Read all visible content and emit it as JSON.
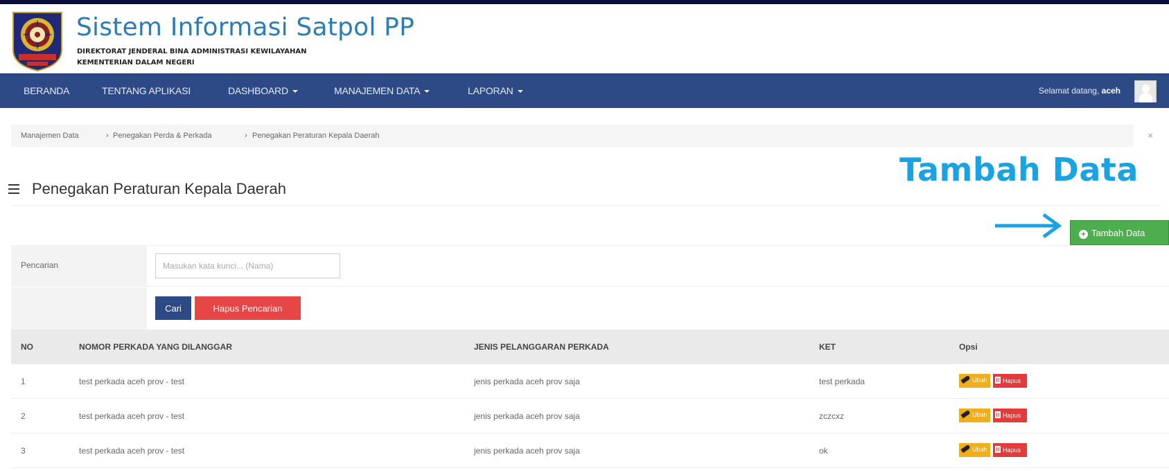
{
  "header": {
    "title": "Sistem Informasi Satpol PP",
    "subtitle_line1": "DIREKTORAT JENDERAL BINA ADMINISTRASI KEWILAYAHAN",
    "subtitle_line2": "KEMENTERIAN DALAM NEGERI"
  },
  "nav": {
    "items": [
      {
        "label": "BERANDA"
      },
      {
        "label": "TENTANG APLIKASI"
      },
      {
        "label": "DASHBOARD"
      },
      {
        "label": "MANAJEMEN DATA"
      },
      {
        "label": "LAPORAN"
      }
    ],
    "welcome_text": "Selamat datang,",
    "username": "aceh"
  },
  "breadcrumb": {
    "items": [
      "Manajemen Data",
      "Penegakan Perda & Perkada",
      "Penegakan Peraturan Kepala Daerah"
    ],
    "separator": "›",
    "close": "×"
  },
  "annotation": {
    "title": "Tambah Data"
  },
  "page": {
    "heading": "Penegakan Peraturan Kepala Daerah",
    "add_button_label": "Tambah Data"
  },
  "search": {
    "label": "Pencarian",
    "placeholder": "Masukan kata kunci... (Nama)",
    "value": "",
    "search_button": "Cari",
    "clear_button": "Hapus Pencarian"
  },
  "table": {
    "headers": [
      "NO",
      "NOMOR PERKADA YANG DILANGGAR",
      "JENIS PELANGGARAN PERKADA",
      "KET",
      "Opsi"
    ],
    "rows": [
      {
        "no": "1",
        "nomor": "test perkada aceh prov - test",
        "jenis": "jenis perkada aceh prov saja",
        "ket": "test perkada",
        "edit": "Ubah",
        "delete": "Hapus"
      },
      {
        "no": "2",
        "nomor": "test perkada aceh prov - test",
        "jenis": "jenis perkada aceh prov saja",
        "ket": "zczcxz",
        "edit": "Ubah",
        "delete": "Hapus"
      },
      {
        "no": "3",
        "nomor": "test perkada aceh prov - test",
        "jenis": "jenis perkada aceh prov saja",
        "ket": "ok",
        "edit": "Ubah",
        "delete": "Hapus"
      }
    ]
  },
  "colors": {
    "navbar": "#2e4a86",
    "title_blue": "#2a7db5",
    "annotation_blue": "#1aa3e3",
    "add_green": "#4cae4c",
    "danger_red": "#e74646",
    "warning_yellow": "#f0ad1e"
  }
}
